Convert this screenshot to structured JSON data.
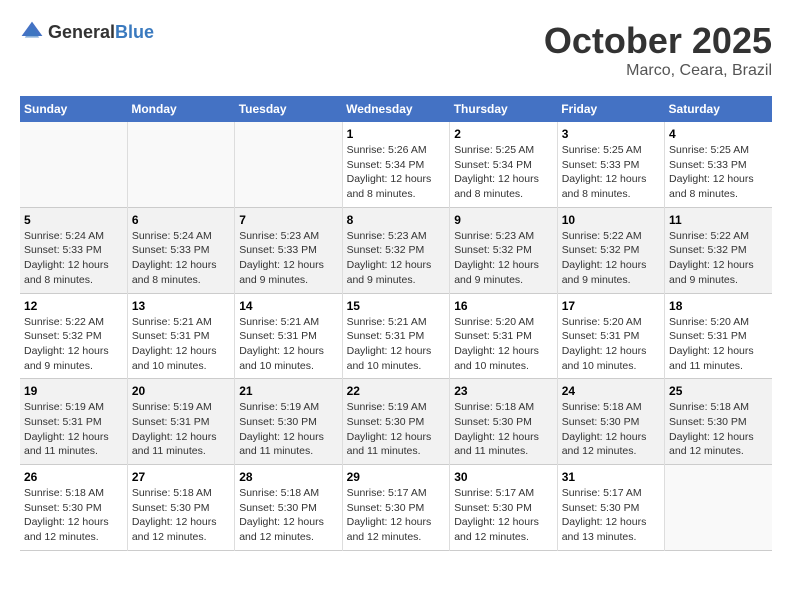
{
  "logo": {
    "general": "General",
    "blue": "Blue"
  },
  "title": "October 2025",
  "subtitle": "Marco, Ceara, Brazil",
  "weekdays": [
    "Sunday",
    "Monday",
    "Tuesday",
    "Wednesday",
    "Thursday",
    "Friday",
    "Saturday"
  ],
  "weeks": [
    [
      {
        "day": "",
        "info": ""
      },
      {
        "day": "",
        "info": ""
      },
      {
        "day": "",
        "info": ""
      },
      {
        "day": "1",
        "info": "Sunrise: 5:26 AM\nSunset: 5:34 PM\nDaylight: 12 hours and 8 minutes."
      },
      {
        "day": "2",
        "info": "Sunrise: 5:25 AM\nSunset: 5:34 PM\nDaylight: 12 hours and 8 minutes."
      },
      {
        "day": "3",
        "info": "Sunrise: 5:25 AM\nSunset: 5:33 PM\nDaylight: 12 hours and 8 minutes."
      },
      {
        "day": "4",
        "info": "Sunrise: 5:25 AM\nSunset: 5:33 PM\nDaylight: 12 hours and 8 minutes."
      }
    ],
    [
      {
        "day": "5",
        "info": "Sunrise: 5:24 AM\nSunset: 5:33 PM\nDaylight: 12 hours and 8 minutes."
      },
      {
        "day": "6",
        "info": "Sunrise: 5:24 AM\nSunset: 5:33 PM\nDaylight: 12 hours and 8 minutes."
      },
      {
        "day": "7",
        "info": "Sunrise: 5:23 AM\nSunset: 5:33 PM\nDaylight: 12 hours and 9 minutes."
      },
      {
        "day": "8",
        "info": "Sunrise: 5:23 AM\nSunset: 5:32 PM\nDaylight: 12 hours and 9 minutes."
      },
      {
        "day": "9",
        "info": "Sunrise: 5:23 AM\nSunset: 5:32 PM\nDaylight: 12 hours and 9 minutes."
      },
      {
        "day": "10",
        "info": "Sunrise: 5:22 AM\nSunset: 5:32 PM\nDaylight: 12 hours and 9 minutes."
      },
      {
        "day": "11",
        "info": "Sunrise: 5:22 AM\nSunset: 5:32 PM\nDaylight: 12 hours and 9 minutes."
      }
    ],
    [
      {
        "day": "12",
        "info": "Sunrise: 5:22 AM\nSunset: 5:32 PM\nDaylight: 12 hours and 9 minutes."
      },
      {
        "day": "13",
        "info": "Sunrise: 5:21 AM\nSunset: 5:31 PM\nDaylight: 12 hours and 10 minutes."
      },
      {
        "day": "14",
        "info": "Sunrise: 5:21 AM\nSunset: 5:31 PM\nDaylight: 12 hours and 10 minutes."
      },
      {
        "day": "15",
        "info": "Sunrise: 5:21 AM\nSunset: 5:31 PM\nDaylight: 12 hours and 10 minutes."
      },
      {
        "day": "16",
        "info": "Sunrise: 5:20 AM\nSunset: 5:31 PM\nDaylight: 12 hours and 10 minutes."
      },
      {
        "day": "17",
        "info": "Sunrise: 5:20 AM\nSunset: 5:31 PM\nDaylight: 12 hours and 10 minutes."
      },
      {
        "day": "18",
        "info": "Sunrise: 5:20 AM\nSunset: 5:31 PM\nDaylight: 12 hours and 11 minutes."
      }
    ],
    [
      {
        "day": "19",
        "info": "Sunrise: 5:19 AM\nSunset: 5:31 PM\nDaylight: 12 hours and 11 minutes."
      },
      {
        "day": "20",
        "info": "Sunrise: 5:19 AM\nSunset: 5:31 PM\nDaylight: 12 hours and 11 minutes."
      },
      {
        "day": "21",
        "info": "Sunrise: 5:19 AM\nSunset: 5:30 PM\nDaylight: 12 hours and 11 minutes."
      },
      {
        "day": "22",
        "info": "Sunrise: 5:19 AM\nSunset: 5:30 PM\nDaylight: 12 hours and 11 minutes."
      },
      {
        "day": "23",
        "info": "Sunrise: 5:18 AM\nSunset: 5:30 PM\nDaylight: 12 hours and 11 minutes."
      },
      {
        "day": "24",
        "info": "Sunrise: 5:18 AM\nSunset: 5:30 PM\nDaylight: 12 hours and 12 minutes."
      },
      {
        "day": "25",
        "info": "Sunrise: 5:18 AM\nSunset: 5:30 PM\nDaylight: 12 hours and 12 minutes."
      }
    ],
    [
      {
        "day": "26",
        "info": "Sunrise: 5:18 AM\nSunset: 5:30 PM\nDaylight: 12 hours and 12 minutes."
      },
      {
        "day": "27",
        "info": "Sunrise: 5:18 AM\nSunset: 5:30 PM\nDaylight: 12 hours and 12 minutes."
      },
      {
        "day": "28",
        "info": "Sunrise: 5:18 AM\nSunset: 5:30 PM\nDaylight: 12 hours and 12 minutes."
      },
      {
        "day": "29",
        "info": "Sunrise: 5:17 AM\nSunset: 5:30 PM\nDaylight: 12 hours and 12 minutes."
      },
      {
        "day": "30",
        "info": "Sunrise: 5:17 AM\nSunset: 5:30 PM\nDaylight: 12 hours and 12 minutes."
      },
      {
        "day": "31",
        "info": "Sunrise: 5:17 AM\nSunset: 5:30 PM\nDaylight: 12 hours and 13 minutes."
      },
      {
        "day": "",
        "info": ""
      }
    ]
  ]
}
